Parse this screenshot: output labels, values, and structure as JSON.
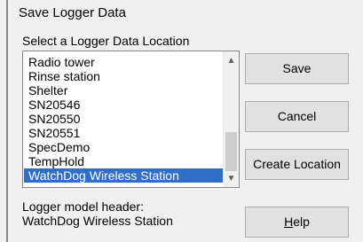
{
  "dialog": {
    "title": "Save Logger Data",
    "prompt": "Select a Logger Data Location"
  },
  "list": {
    "items": [
      {
        "label": "Radio tower",
        "selected": false
      },
      {
        "label": "Rinse station",
        "selected": false
      },
      {
        "label": "Shelter",
        "selected": false
      },
      {
        "label": "SN20546",
        "selected": false
      },
      {
        "label": "SN20550",
        "selected": false
      },
      {
        "label": "SN20551",
        "selected": false
      },
      {
        "label": "SpecDemo",
        "selected": false
      },
      {
        "label": "TempHold",
        "selected": false
      },
      {
        "label": "WatchDog Wireless Station",
        "selected": true
      }
    ],
    "scroll_up_icon": "chevron-up-icon",
    "scroll_down_icon": "chevron-down-icon"
  },
  "buttons": {
    "save_label": "Save",
    "cancel_label": "Cancel",
    "create_location_label": "Create Location",
    "help_mnemonic": "H",
    "help_rest": "elp"
  },
  "model": {
    "label": "Logger model  header:",
    "value": "WatchDog Wireless Station"
  },
  "colors": {
    "selection": "#2f6fc9",
    "dialog_background": "#f0f0f0",
    "button_background": "#e1e1e1"
  }
}
